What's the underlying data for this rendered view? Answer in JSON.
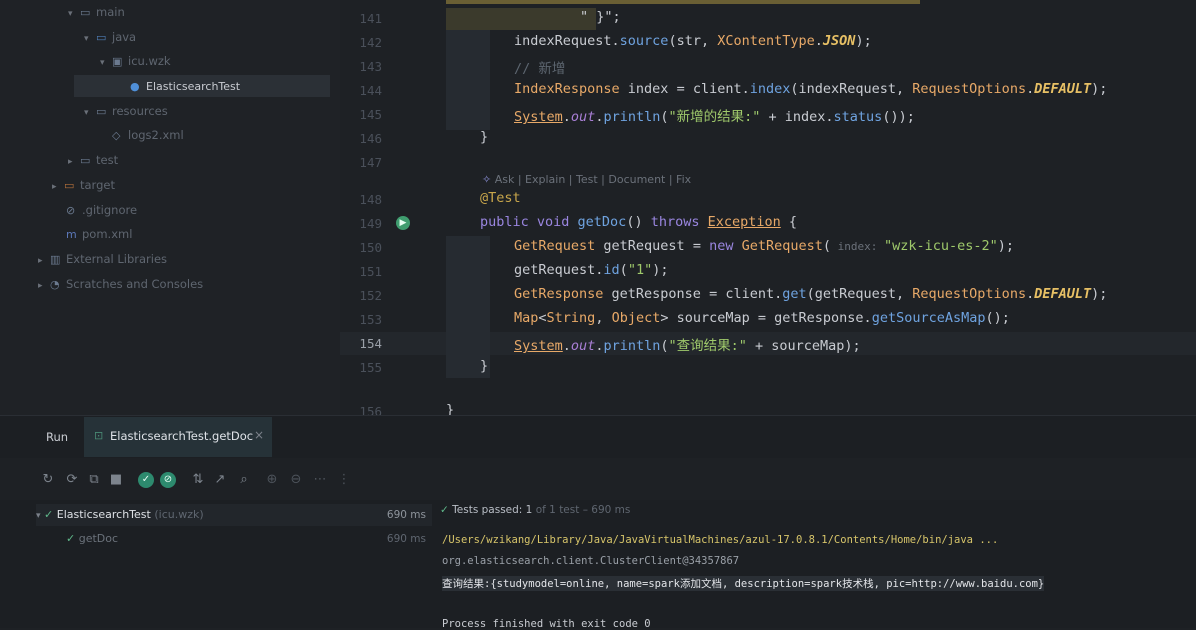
{
  "tree": {
    "items": [
      {
        "label": "main",
        "chev": "▾",
        "icon": "folder-icon"
      },
      {
        "label": "java",
        "chev": "▾",
        "icon": "folder-icon"
      },
      {
        "label": "icu.wzk",
        "chev": "▾",
        "icon": "package-icon"
      },
      {
        "label": "ElasticsearchTest",
        "chev": "",
        "icon": "class-icon"
      },
      {
        "label": "resources",
        "chev": "▾",
        "icon": "folder-icon"
      },
      {
        "label": "logs2.xml",
        "chev": "",
        "icon": "xml-icon"
      },
      {
        "label": "test",
        "chev": "▸",
        "icon": "folder-icon"
      },
      {
        "label": "target",
        "chev": "▸",
        "icon": "folder-icon"
      },
      {
        "label": ".gitignore",
        "chev": "",
        "icon": "gitignore-icon"
      },
      {
        "label": "pom.xml",
        "chev": "",
        "icon": "maven-icon"
      },
      {
        "label": "External Libraries",
        "chev": "▸",
        "icon": "library-icon"
      },
      {
        "label": "Scratches and Consoles",
        "chev": "▸",
        "icon": "scratch-icon"
      }
    ]
  },
  "editor": {
    "line_numbers": [
      "141",
      "142",
      "143",
      "144",
      "145",
      "146",
      "147",
      "148",
      "149",
      "150",
      "151",
      "152",
      "153",
      "154",
      "155",
      "156"
    ],
    "lines": {
      "l141": "\" }\";",
      "l142_a": "indexRequest.",
      "l142_b": "source",
      "l142_c": "(str, ",
      "l142_d": "XContentType",
      "l142_e": ".",
      "l142_f": "JSON",
      "l142_g": ");",
      "l143": "// 新增",
      "l144_a": "IndexResponse",
      "l144_b": " index = client.",
      "l144_c": "index",
      "l144_d": "(indexRequest, ",
      "l144_e": "RequestOptions",
      "l144_f": ".",
      "l144_g": "DEFAULT",
      "l144_h": ");",
      "l145_a": "System",
      "l145_b": ".",
      "l145_c": "out",
      "l145_d": ".",
      "l145_e": "println",
      "l145_f": "(",
      "l145_g": "\"新增的结果:\"",
      "l145_h": " + index.",
      "l145_i": "status",
      "l145_j": "());",
      "l146": "}",
      "hint": "Ask | Explain | Test | Document | Fix",
      "l148": "@Test",
      "l149_a": "public void ",
      "l149_b": "getDoc",
      "l149_c": "() ",
      "l149_d": "throws ",
      "l149_e": "Exception",
      "l149_f": " {",
      "l150_a": "GetRequest",
      "l150_b": " getRequest = ",
      "l150_c": "new ",
      "l150_d": "GetRequest",
      "l150_e": "(",
      "l150_f": " index: ",
      "l150_g": "\"wzk-icu-es-2\"",
      "l150_h": ");",
      "l151_a": "getRequest.",
      "l151_b": "id",
      "l151_c": "(",
      "l151_d": "\"1\"",
      "l151_e": ");",
      "l152_a": "GetResponse",
      "l152_b": " getResponse = client.",
      "l152_c": "get",
      "l152_d": "(getRequest, ",
      "l152_e": "RequestOptions",
      "l152_f": ".",
      "l152_g": "DEFAULT",
      "l152_h": ");",
      "l153_a": "Map",
      "l153_b": "<",
      "l153_c": "String",
      "l153_d": ", ",
      "l153_e": "Object",
      "l153_f": "> sourceMap = getResponse.",
      "l153_g": "getSourceAsMap",
      "l153_h": "();",
      "l154_a": "System",
      "l154_b": ".",
      "l154_c": "out",
      "l154_d": ".",
      "l154_e": "println",
      "l154_f": "(",
      "l154_g": "\"查询结果:\"",
      "l154_h": " + sourceMap);",
      "l155": "}",
      "l157": "}"
    }
  },
  "run": {
    "label": "Run",
    "tab_label": "ElasticsearchTest.getDoc",
    "tab_close": "×",
    "toolbar_icons": [
      "rerun-icon",
      "rerun-failed-icon",
      "toggle-auto-test-icon",
      "stop-icon",
      "show-passed-icon",
      "show-ignored-icon",
      "sort-alpha-icon",
      "sort-duration-icon",
      "search-icon",
      "expand-icon",
      "collapse-icon",
      "more-icon"
    ],
    "tests": [
      {
        "name": "ElasticsearchTest",
        "pkg": "(icu.wzk)",
        "time": "690 ms"
      },
      {
        "name": "getDoc",
        "pkg": "",
        "time": "690 ms"
      }
    ],
    "status": "Tests passed: 1",
    "status_detail": "of 1 test – 690 ms",
    "console": [
      "/Users/wzikang/Library/Java/JavaVirtualMachines/azul-17.0.8.1/Contents/Home/bin/java ...",
      "org.elasticsearch.client.ClusterClient@34357867",
      "查询结果:{studymodel=online, name=spark添加文档, description=spark技术栈, pic=http://www.baidu.com}",
      "",
      "Process finished with exit code 0"
    ]
  },
  "colors": {
    "accent": "#2d8a6e",
    "background": "#1e2125",
    "keyword": "#9a86e0",
    "type": "#e8a968",
    "method": "#6fa3e0",
    "string": "#9fc96b"
  }
}
